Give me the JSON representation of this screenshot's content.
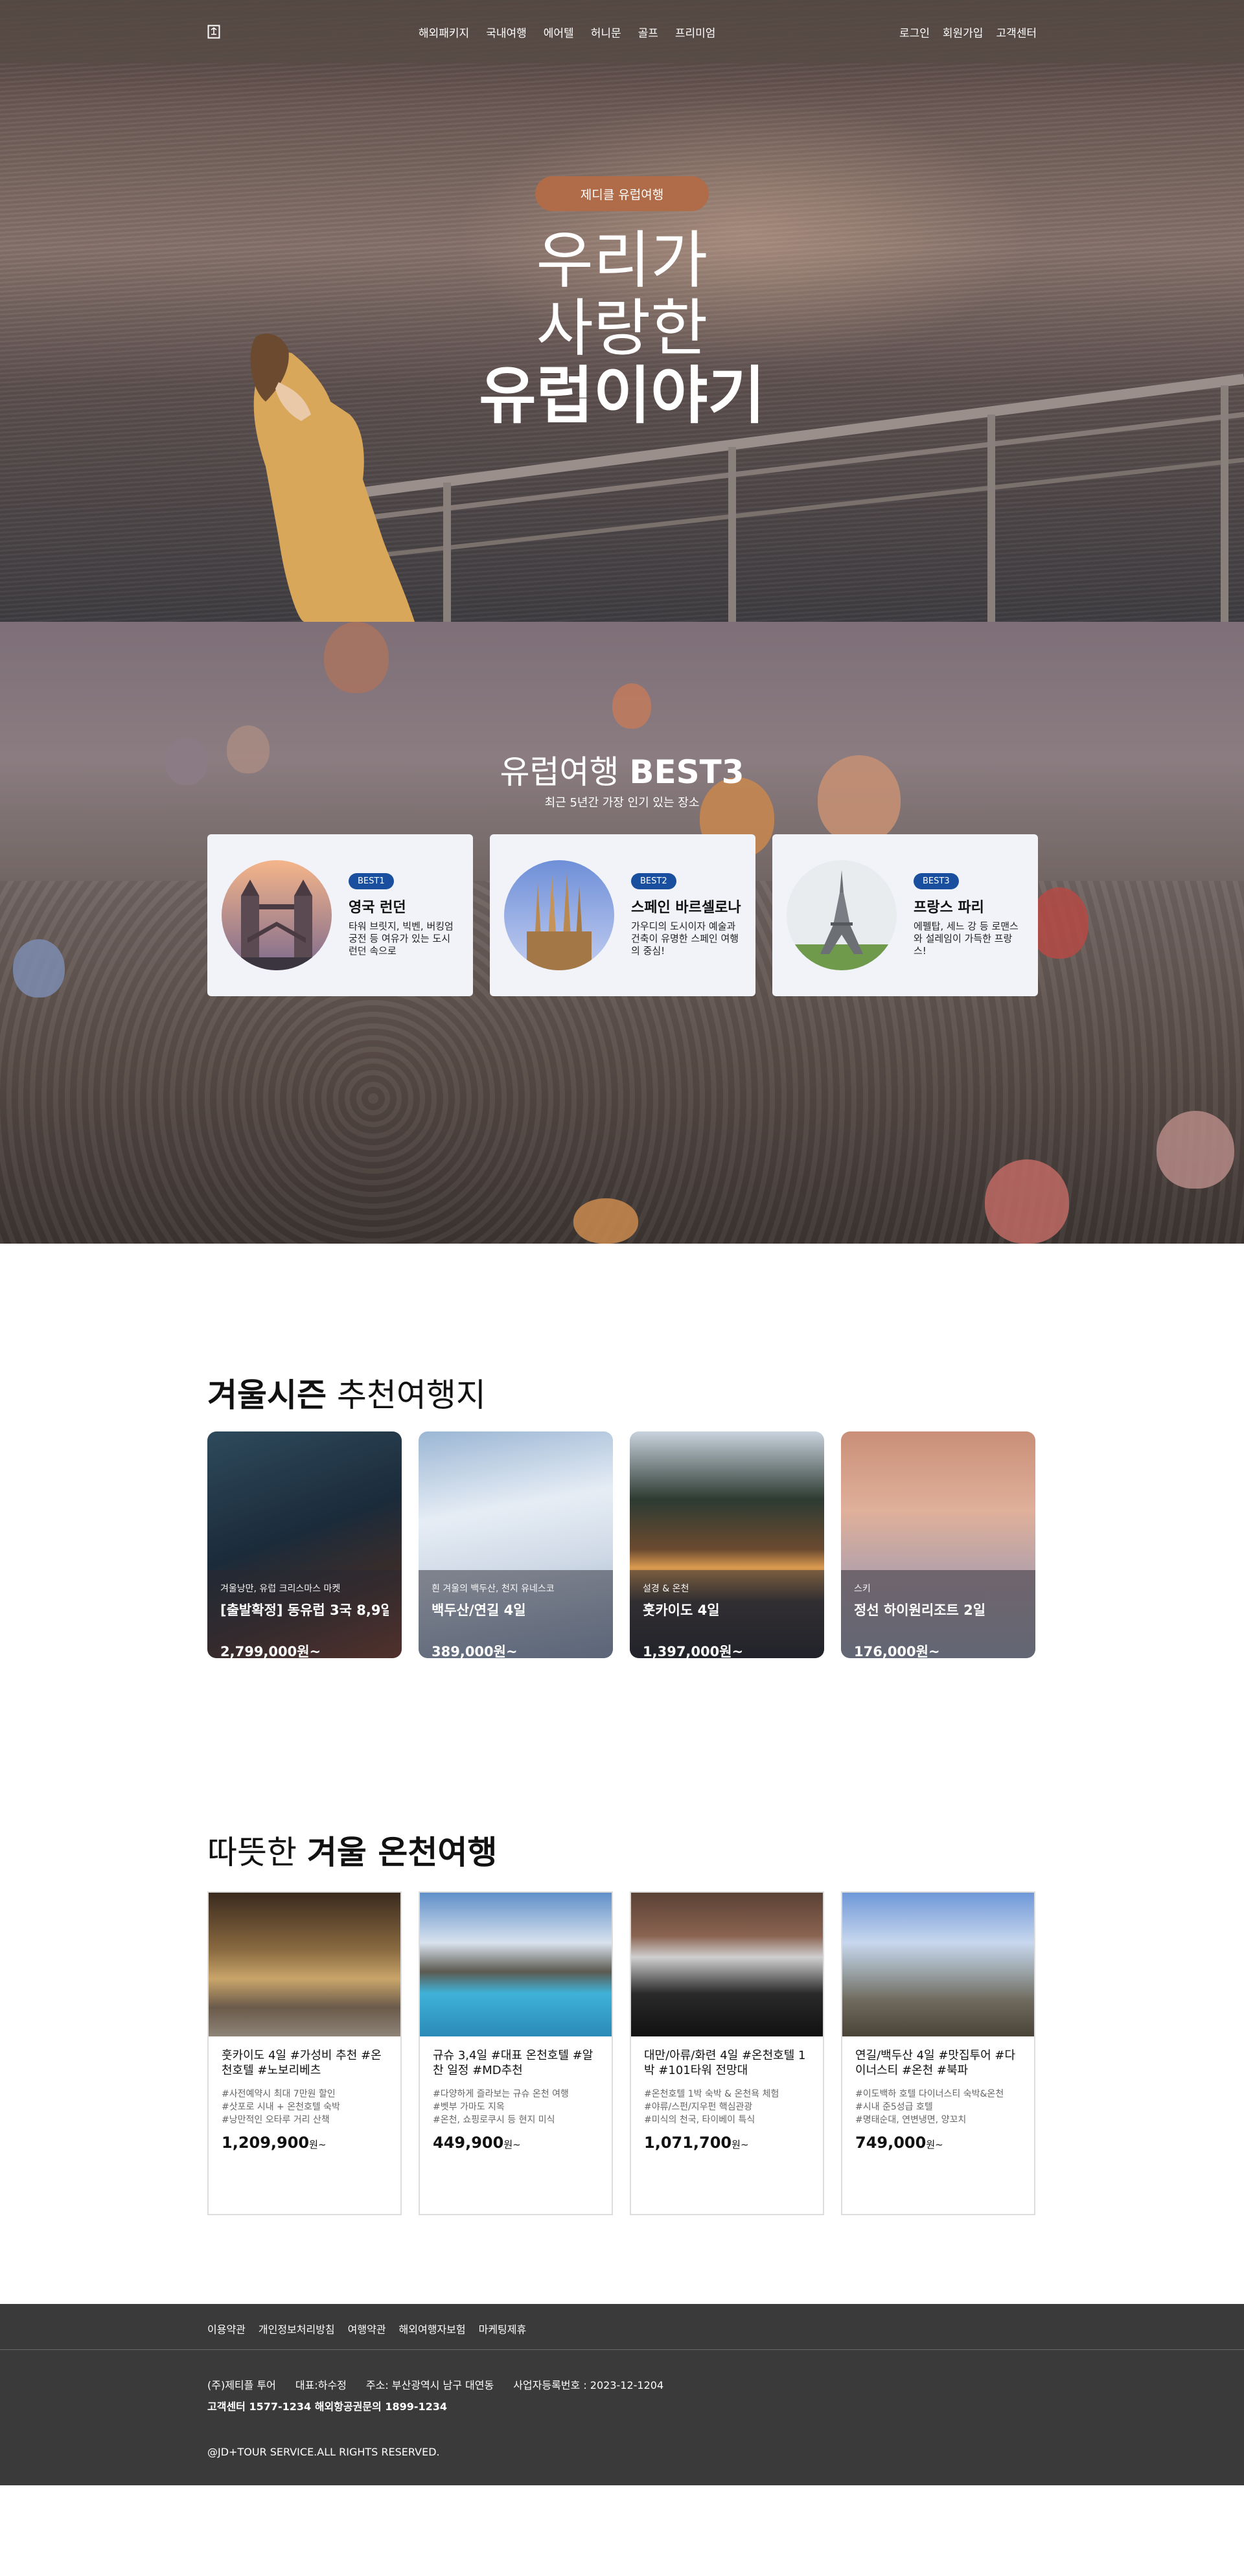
{
  "header": {
    "nav": [
      "해외패키지",
      "국내여행",
      "에어텔",
      "허니문",
      "골프",
      "프리미엄"
    ],
    "util": [
      "로그인",
      "회원가입",
      "고객센터"
    ]
  },
  "hero": {
    "badge": "제디클 유럽여행",
    "title_line1": "우리가",
    "title_line2": "사랑한",
    "title_line3": "유럽이야기"
  },
  "best": {
    "title_light": "유럽여행 ",
    "title_bold": "BEST3",
    "subtitle": "최근 5년간 가장 인기 있는 장소",
    "cards": [
      {
        "badge": "BEST1",
        "name": "영국 런던",
        "desc": "타워 브릿지, 빅벤, 버킹엄 궁전 등 여유가 있는 도시 런던 속으로"
      },
      {
        "badge": "BEST2",
        "name": "스페인 바르셀로나",
        "desc": "가우디의 도시이자 예술과 건축이 유명한 스페인 여행의 중심!"
      },
      {
        "badge": "BEST3",
        "name": "프랑스 파리",
        "desc": "에펠탑, 세느 강 등 로맨스와 설레임이 가득한 프랑스!"
      }
    ]
  },
  "winter": {
    "title_bold": "겨울시즌",
    "title_light": " 추천여행지",
    "cards": [
      {
        "tag": "겨울낭만, 유럽 크리스마스 마켓",
        "name": "[출발확정] 동유럽 3국 8,9일",
        "price": "2,799,000원~"
      },
      {
        "tag": "흰 겨울의 백두산, 천지 유네스코",
        "name": "백두산/연길 4일",
        "price": "389,000원~"
      },
      {
        "tag": "설경 & 온천",
        "name": "훗카이도 4일",
        "price": "1,397,000원~"
      },
      {
        "tag": "스키",
        "name": "정선 하이원리조트 2일",
        "price": "176,000원~"
      }
    ]
  },
  "onsen": {
    "title_light": "따뜻한 ",
    "title_bold": "겨울 온천여행",
    "cards": [
      {
        "name": "훗카이도 4일 #가성비 추천 #온천호텔 #노보리베츠",
        "tags": [
          "#사전예약시 최대 7만원 할인",
          "#삿포로 시내 + 온천호텔 숙박",
          "#낭만적인 오타루 거리 산책"
        ],
        "price": "1,209,900",
        "unit": "원~"
      },
      {
        "name": "규슈 3,4일 #대표 온천호텔 #알찬 일정 #MD추천",
        "tags": [
          "#다양하게 즐라보는 규슈 온천 여행",
          "#벳부 가마도 지옥",
          "#온천, 쇼핑로쿠시 등 현지 미식"
        ],
        "price": "449,900",
        "unit": "원~"
      },
      {
        "name": "대만/아류/화련 4일 #온천호텔 1박 #101타워 전망대",
        "tags": [
          "#온천호텔 1박 숙박 & 온천욕 체험",
          "#야류/스펀/지우펀 핵심관광",
          "#미식의 천국, 타이베이 특식"
        ],
        "price": "1,071,700",
        "unit": "원~"
      },
      {
        "name": "연길/백두산 4일 #맛집투어 #다이너스티 #온천 #북파",
        "tags": [
          "#이도백하 호텔 다이너스티 숙박&온천",
          "#시내 준5성급 호텔",
          "#명태순대, 연변냉면, 양꼬치"
        ],
        "price": "749,000",
        "unit": "원~"
      }
    ]
  },
  "footer": {
    "links": [
      "이용약관",
      "개인정보처리방침",
      "여행약관",
      "해외여행자보험",
      "마케팅제휴"
    ],
    "company": "(주)제티플 투어",
    "ceo": "대표:하수정",
    "address": "주소: 부산광역시 남구 대연동",
    "bizno": "사업자등록번호 : 2023-12-1204",
    "cs": "고객센터 1577-1234  해외항공권문의 1899-1234",
    "copyright": "@JD+TOUR SERVICE.ALL RIGHTS RESERVED."
  },
  "colors": {
    "header_bg": "#584c46",
    "badge_brown": "#b06c48",
    "best_badge_blue": "#1a4fa0",
    "footer_bg": "#3a3a3a"
  }
}
